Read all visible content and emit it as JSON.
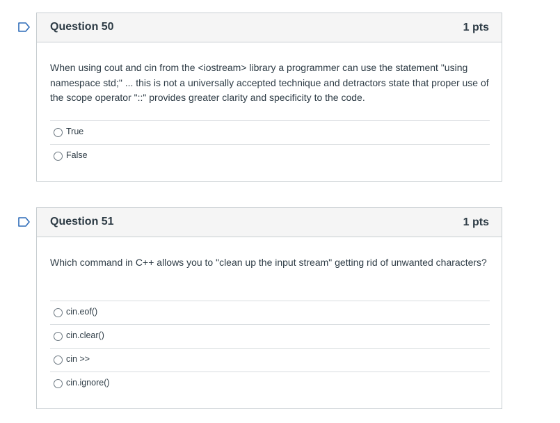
{
  "questions": [
    {
      "title": "Question 50",
      "points": "1 pts",
      "text": "When using cout and cin from the <iostream> library a programmer can use the statement \"using namespace std;\" ... this is not a universally accepted technique and detractors state that proper use of the scope operator \"::\" provides greater clarity and specificity to the code.",
      "answers": [
        "True",
        "False"
      ]
    },
    {
      "title": "Question 51",
      "points": "1 pts",
      "text": "Which command in C++ allows you to \"clean up the input stream\" getting rid of unwanted characters?",
      "answers": [
        "cin.eof()",
        "cin.clear()",
        "cin >>",
        "cin.ignore()"
      ]
    }
  ],
  "colors": {
    "flag": "#2d6bb8",
    "header_bg": "#f5f5f5",
    "border": "#c7cdd1",
    "text": "#2d3b45"
  },
  "icons": {
    "flag": "bookmark-flag-icon",
    "radio": "radio-button-icon"
  }
}
